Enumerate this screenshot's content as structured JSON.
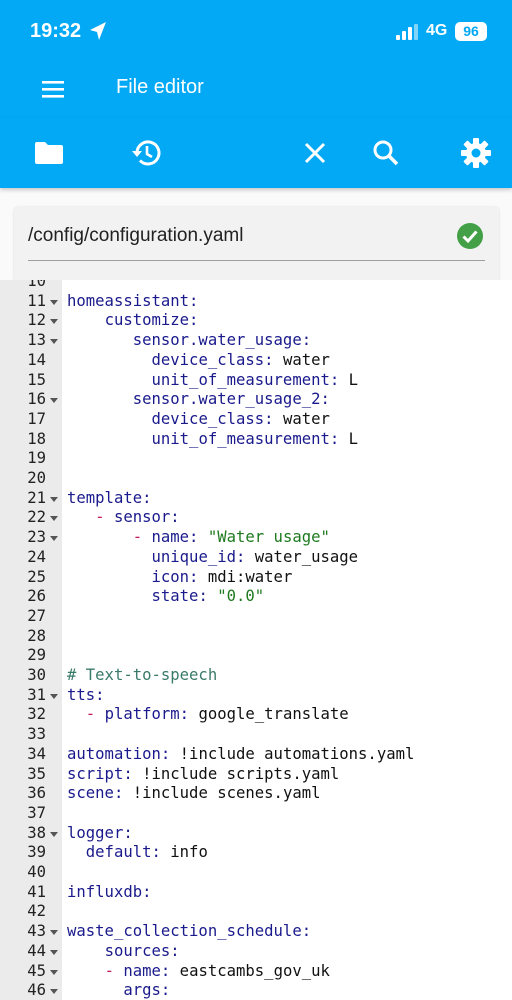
{
  "status": {
    "time": "19:32",
    "network": "4G",
    "battery": "96"
  },
  "appbar": {
    "title": "File editor"
  },
  "toolbar": {
    "icons": [
      "folder-icon",
      "history-icon",
      "close-icon",
      "search-icon",
      "gear-icon"
    ]
  },
  "file": {
    "path": "/config/configuration.yaml",
    "saved_status_icon": "check-circle-icon"
  },
  "colors": {
    "primary": "#03a9f4",
    "success": "#43a047",
    "key": "#1a1a8c",
    "string": "#1e7a1e",
    "comment": "#3a7a6a"
  },
  "editor": {
    "lines": [
      {
        "n": "10",
        "text": ""
      },
      {
        "n": "11",
        "text": "homeassistant:",
        "fold": true
      },
      {
        "n": "12",
        "text": "    customize:",
        "fold": true
      },
      {
        "n": "13",
        "text": "       sensor.water_usage:",
        "fold": true
      },
      {
        "n": "14",
        "text": "         device_class: water"
      },
      {
        "n": "15",
        "text": "         unit_of_measurement: L"
      },
      {
        "n": "16",
        "text": "       sensor.water_usage_2:",
        "fold": true
      },
      {
        "n": "17",
        "text": "         device_class: water"
      },
      {
        "n": "18",
        "text": "         unit_of_measurement: L"
      },
      {
        "n": "19",
        "text": ""
      },
      {
        "n": "20",
        "text": ""
      },
      {
        "n": "21",
        "text": "template:",
        "fold": true
      },
      {
        "n": "22",
        "text": "   - sensor:",
        "fold": true
      },
      {
        "n": "23",
        "text": "       - name: \"Water usage\"",
        "fold": true
      },
      {
        "n": "24",
        "text": "         unique_id: water_usage"
      },
      {
        "n": "25",
        "text": "         icon: mdi:water"
      },
      {
        "n": "26",
        "text": "         state: \"0.0\""
      },
      {
        "n": "27",
        "text": ""
      },
      {
        "n": "28",
        "text": ""
      },
      {
        "n": "29",
        "text": ""
      },
      {
        "n": "30",
        "text": "# Text-to-speech"
      },
      {
        "n": "31",
        "text": "tts:",
        "fold": true
      },
      {
        "n": "32",
        "text": "  - platform: google_translate"
      },
      {
        "n": "33",
        "text": ""
      },
      {
        "n": "34",
        "text": "automation: !include automations.yaml"
      },
      {
        "n": "35",
        "text": "script: !include scripts.yaml"
      },
      {
        "n": "36",
        "text": "scene: !include scenes.yaml"
      },
      {
        "n": "37",
        "text": ""
      },
      {
        "n": "38",
        "text": "logger:",
        "fold": true
      },
      {
        "n": "39",
        "text": "  default: info"
      },
      {
        "n": "40",
        "text": ""
      },
      {
        "n": "41",
        "text": "influxdb:"
      },
      {
        "n": "42",
        "text": ""
      },
      {
        "n": "43",
        "text": "waste_collection_schedule:",
        "fold": true
      },
      {
        "n": "44",
        "text": "    sources:",
        "fold": true
      },
      {
        "n": "45",
        "text": "    - name: eastcambs_gov_uk",
        "fold": true
      },
      {
        "n": "46",
        "text": "      args:",
        "fold": true
      }
    ]
  }
}
